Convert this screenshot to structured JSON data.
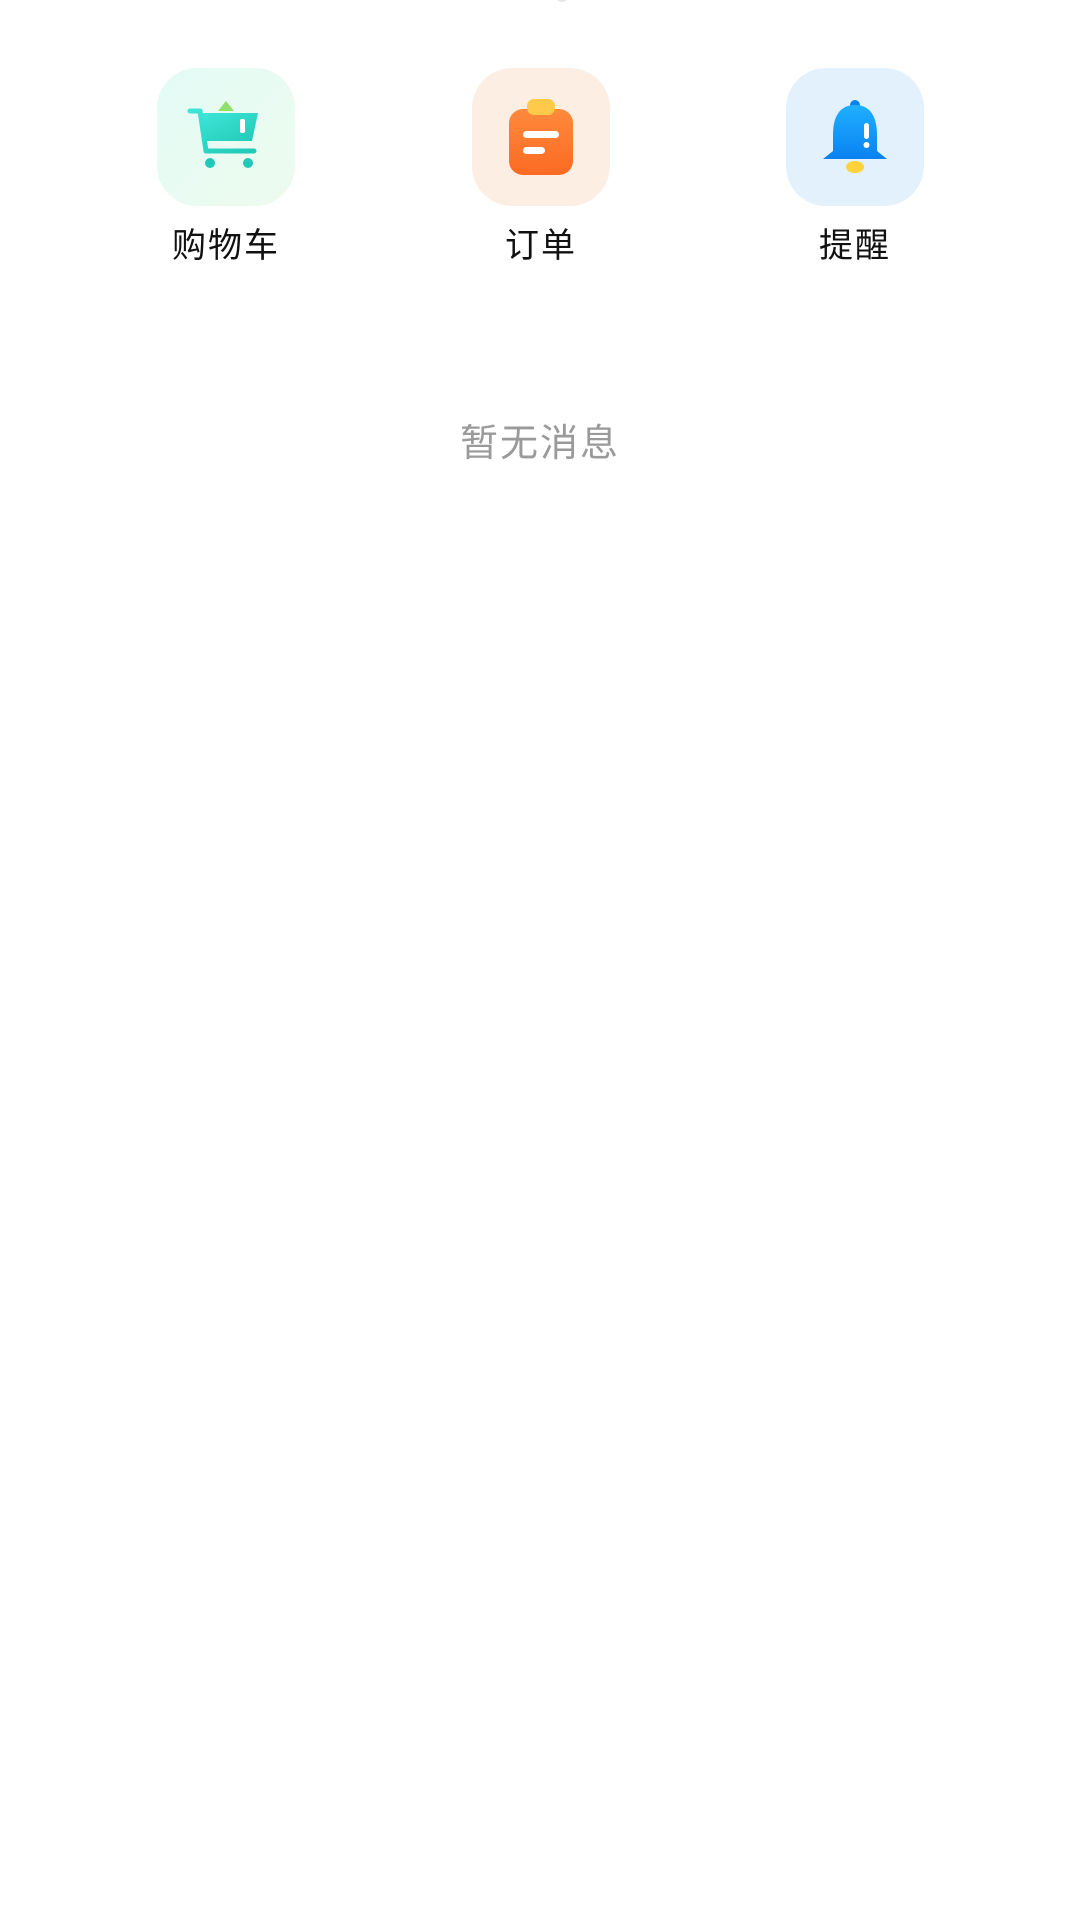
{
  "quick_actions": [
    {
      "label": "购物车",
      "icon": "shopping-cart-icon",
      "color": "#2fd9c6",
      "bg": "#e6fbf3"
    },
    {
      "label": "订单",
      "icon": "order-clipboard-icon",
      "color": "#ff7a2e",
      "bg": "#fdeee3"
    },
    {
      "label": "提醒",
      "icon": "bell-icon",
      "color": "#1499ff",
      "bg": "#e3f1fd"
    }
  ],
  "empty_state": {
    "message": "暂无消息"
  }
}
